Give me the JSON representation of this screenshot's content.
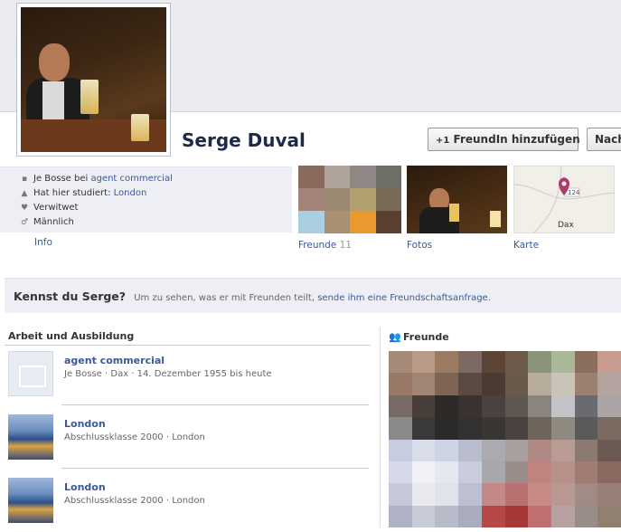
{
  "profile": {
    "name": "Serge Duval",
    "add_friend_label": "FreundIn hinzufügen",
    "message_label": "Nachricht"
  },
  "info": {
    "lines": [
      {
        "icon": "briefcase-icon",
        "prefix": "Je Bosse bei ",
        "link": "agent commercial"
      },
      {
        "icon": "graduation-cap-icon",
        "prefix": "Hat hier studiert: ",
        "link": "London"
      },
      {
        "icon": "heart-icon",
        "prefix": "Verwitwet",
        "link": ""
      },
      {
        "icon": "male-icon",
        "prefix": "Männlich",
        "link": ""
      }
    ],
    "info_link": "Info"
  },
  "tiles": {
    "friends_label": "Freunde",
    "friends_count": "11",
    "photos_label": "Fotos",
    "map_label": "Karte",
    "map_city": "Dax",
    "map_road": "124"
  },
  "prompt": {
    "title": "Kennst du Serge?",
    "text": "Um zu sehen, was er mit Freunden teilt,",
    "link": "sende ihm eine Freundschaftsanfrage."
  },
  "work": {
    "header": "Arbeit und Ausbildung",
    "items": [
      {
        "title": "agent commercial",
        "sub": "Je Bosse · Dax · 14. Dezember 1955 bis heute"
      },
      {
        "title": "London",
        "sub": "Abschlussklasse 2000 · London"
      },
      {
        "title": "London",
        "sub": "Abschlussklasse 2000 · London"
      }
    ]
  },
  "friends_section": {
    "header": "Freunde"
  }
}
